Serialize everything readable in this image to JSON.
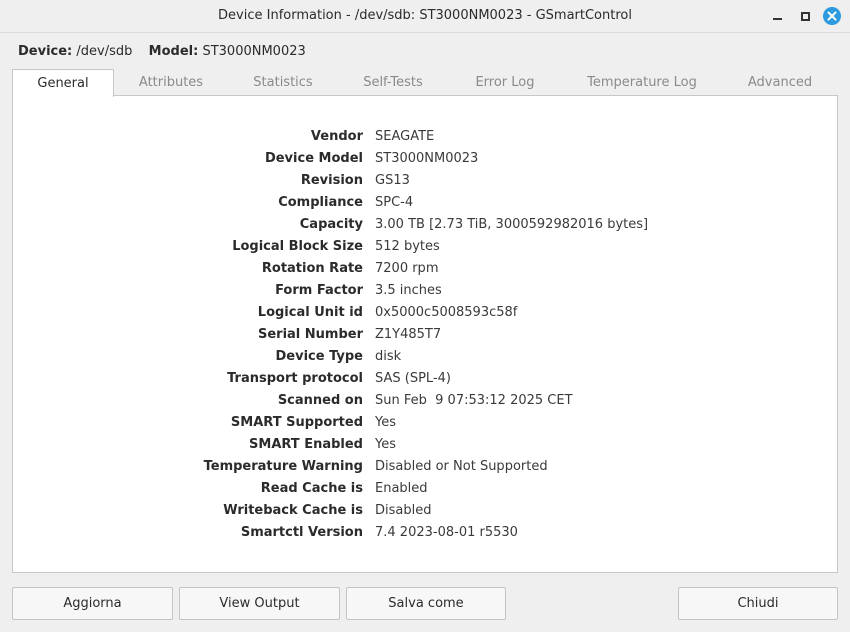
{
  "window": {
    "title": "Device Information - /dev/sdb: ST3000NM0023 - GSmartControl"
  },
  "device_header": {
    "device_label": "Device:",
    "device_value": "/dev/sdb",
    "model_label": "Model:",
    "model_value": "ST3000NM0023"
  },
  "tabs": [
    {
      "label": "General",
      "active": true
    },
    {
      "label": "Attributes",
      "active": false
    },
    {
      "label": "Statistics",
      "active": false
    },
    {
      "label": "Self-Tests",
      "active": false
    },
    {
      "label": "Error Log",
      "active": false
    },
    {
      "label": "Temperature Log",
      "active": false
    },
    {
      "label": "Advanced",
      "active": false
    }
  ],
  "general": [
    {
      "label": "Vendor",
      "value": "SEAGATE"
    },
    {
      "label": "Device Model",
      "value": "ST3000NM0023"
    },
    {
      "label": "Revision",
      "value": "GS13"
    },
    {
      "label": "Compliance",
      "value": "SPC-4"
    },
    {
      "label": "Capacity",
      "value": "3.00 TB [2.73 TiB, 3000592982016 bytes]"
    },
    {
      "label": "Logical Block Size",
      "value": "512 bytes"
    },
    {
      "label": "Rotation Rate",
      "value": "7200 rpm"
    },
    {
      "label": "Form Factor",
      "value": "3.5 inches"
    },
    {
      "label": "Logical Unit id",
      "value": "0x5000c5008593c58f"
    },
    {
      "label": "Serial Number",
      "value": "Z1Y485T7"
    },
    {
      "label": "Device Type",
      "value": "disk"
    },
    {
      "label": "Transport protocol",
      "value": "SAS (SPL-4)"
    },
    {
      "label": "Scanned on",
      "value": "Sun Feb  9 07:53:12 2025 CET"
    },
    {
      "label": "SMART Supported",
      "value": "Yes"
    },
    {
      "label": "SMART Enabled",
      "value": "Yes"
    },
    {
      "label": "Temperature Warning",
      "value": "Disabled or Not Supported"
    },
    {
      "label": "Read Cache is",
      "value": "Enabled"
    },
    {
      "label": "Writeback Cache is",
      "value": "Disabled"
    },
    {
      "label": "Smartctl Version",
      "value": "7.4 2023-08-01 r5530"
    }
  ],
  "buttons": {
    "refresh": "Aggiorna",
    "view_output": "View Output",
    "save_as": "Salva come",
    "close": "Chiudi"
  },
  "colors": {
    "close_button": "#2e9be0",
    "panel_background": "#ffffff",
    "window_background": "#efefef"
  }
}
